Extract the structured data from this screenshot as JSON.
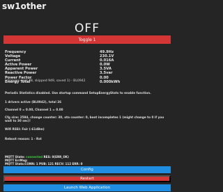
{
  "header": {
    "title": "sw1other"
  },
  "state": {
    "power": "OFF",
    "toggle_label": "Toggle 1"
  },
  "metrics": [
    {
      "label": "Frequency",
      "value": "49.9Hz"
    },
    {
      "label": "Voltage",
      "value": "230.1V"
    },
    {
      "label": "Current",
      "value": "0.016A"
    },
    {
      "label": "Active Power",
      "value": "0.0W"
    },
    {
      "label": "Apparent Power",
      "value": "3.5VA"
    },
    {
      "label": "Reactive Power",
      "value": "3.5var"
    },
    {
      "label": "Power Factor",
      "value": "0.00"
    },
    {
      "label": "Energy Total",
      "value": "0.000kWh"
    }
  ],
  "changes_note": "(changes sent 48, skipped 949, saved 1) - BL0942",
  "info": {
    "periodic": "Periodic Statistics disabled. Use startup command SetupEnergyStats to enable function.",
    "drivers": "1 drivers active (BL0942), total 26",
    "channels": "Channel 0 = 0.00, Channel 1 = 0.00",
    "cfg_size": "Cfg size: 2584, change counter: 30, ota counter: 0, boot incompletes 1 (might change to 0 if you wait to 30 sec)!",
    "wifi": "Wifi RSSI: Fair (-61dBm)",
    "reboot": "Reboot reason: 1 - Rst"
  },
  "mqtt": {
    "state_label": "MQTT State:",
    "state_value": "connected",
    "state_rest": " RES: 0(ERR_OK)",
    "errmsg": "MQTT ErrMsg:",
    "stats": "MQTT Stats:CONN: 1 PUB: 121 RECV: 112 ERR: 0"
  },
  "buttons": {
    "config": "Config",
    "restart": "Restart",
    "launch": "Launch Web Application"
  },
  "colors": {
    "background": "#252525",
    "red": "#d43535",
    "blue": "#1f8de2",
    "green": "#3ccb3c"
  }
}
